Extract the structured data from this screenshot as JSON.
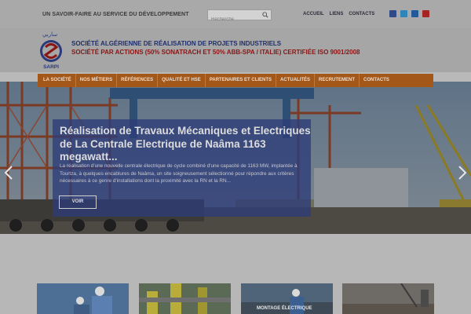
{
  "topbar": {
    "tagline": "UN SAVOIR-FAIRE AU SERVICE DU DÉVELOPPEMENT",
    "search_placeholder": "Recherche",
    "links": [
      "ACCUEIL",
      "LIENS",
      "CONTACTS"
    ],
    "social": [
      "facebook-icon",
      "twitter-icon",
      "linkedin-icon",
      "youtube-icon"
    ]
  },
  "header": {
    "logo_text": "SARPI",
    "company_line1": "SOCIÉTÉ ALGÉRIENNE DE RÉALISATION DE PROJETS INDUSTRIELS",
    "company_line2": "SOCIÉTÉ PAR ACTIONS (50% SONATRACH ET 50% ABB-SPA / ITALIE) CERTIFIÉE ISO 9001/2008"
  },
  "nav": {
    "items": [
      "LA SOCIÉTÉ",
      "NOS MÉTIERS",
      "RÉFÉRENCES",
      "QUALITÉ ET HSE",
      "PARTENAIRES ET CLIENTS",
      "ACTUALITÉS",
      "RECRUTEMENT",
      "CONTACTS"
    ]
  },
  "slide": {
    "title": "Réalisation de Travaux Mécaniques et Electriques de La Centrale Electrique de Naâma 1163 megawatt...",
    "text": "La réalisation d'une nouvelle centrale électrique de cycle combiné d'une capacité de 1163 MW, implantée à Tourtza, à quelques encablures de Naâma, un site soigneusement sélectionné pour répondre aux critères nécessaires à ce genre d'installations dont la proximité avec la RN et la RN...",
    "button": "VOIR"
  },
  "thumbs": {
    "third_label": "MONTAGE ÉLECTRIQUE"
  },
  "colors": {
    "nav_bg": "#a3581a",
    "caption_bg": "#2d3c78",
    "company_blue": "#1f2f6e",
    "company_red": "#8b1515"
  }
}
